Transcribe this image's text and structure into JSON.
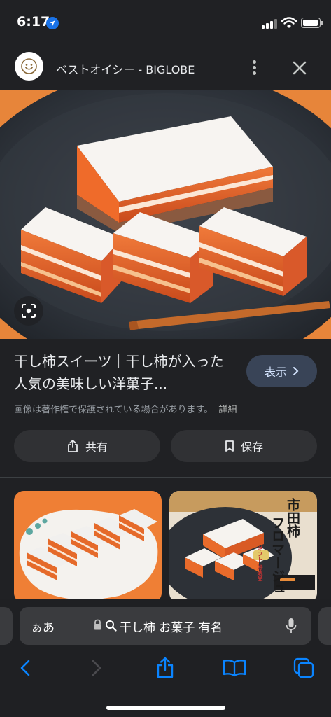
{
  "status_bar": {
    "time": "6:17"
  },
  "source": {
    "site_name": "ベストオイシー - BIGLOBE"
  },
  "result": {
    "title": "干し柿スイーツ｜干し柿が入った人気の美味しい洋菓子...",
    "view_button": "表示",
    "copyright_note": "画像は著作権で保護されている場合があります。",
    "details_link": "詳細",
    "share_label": "共有",
    "save_label": "保存"
  },
  "related": {
    "thumb2_title_line1": "市田柿",
    "thumb2_title_line2": "フロマージュ",
    "thumb2_tag": "ギフト 好適品"
  },
  "safari": {
    "aa_label": "ぁあ",
    "address_text": "干し柿 お菓子 有名"
  },
  "colors": {
    "background": "#202124",
    "view_button_bg": "#394457",
    "ios_blue": "#0a84ff",
    "accent_orange": "#e8622c"
  }
}
